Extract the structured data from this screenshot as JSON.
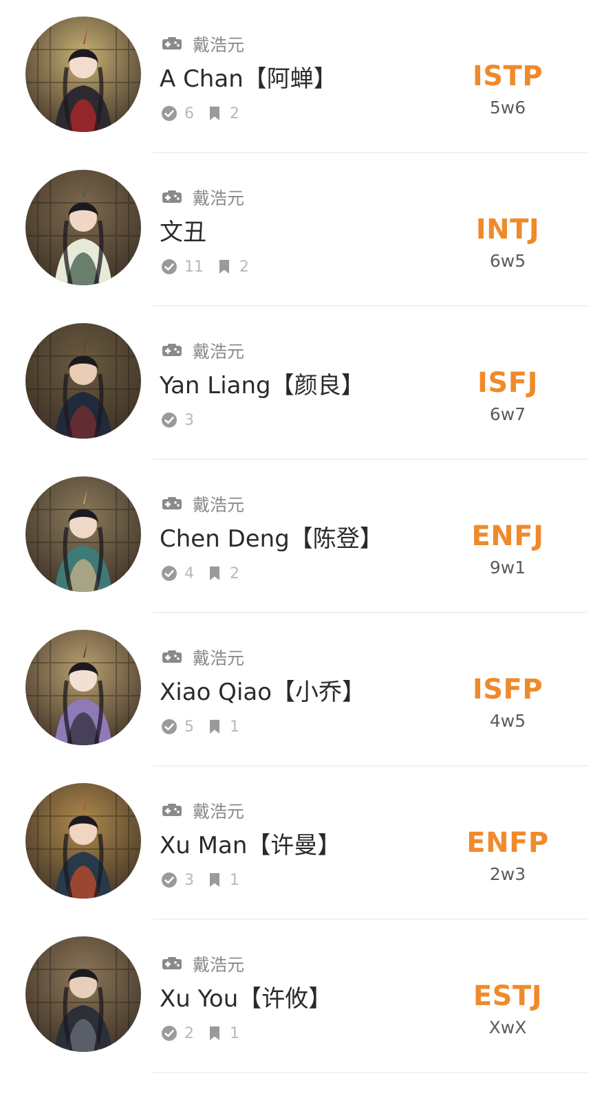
{
  "characters": [
    {
      "source": "戴浩元",
      "name": "A Chan【阿蝉】",
      "votes": "6",
      "bookmarks": "2",
      "mbti": "ISTP",
      "enneagram": "5w6",
      "palette": {
        "bg": "#c9b176",
        "robe": "#2c2a30",
        "accent": "#b4262a",
        "skin": "#f2dccb"
      }
    },
    {
      "source": "戴浩元",
      "name": "文丑",
      "votes": "11",
      "bookmarks": "2",
      "mbti": "INTJ",
      "enneagram": "6w5",
      "palette": {
        "bg": "#7d6a4e",
        "robe": "#e6ead8",
        "accent": "#3f5a4a",
        "skin": "#f0d6c4"
      }
    },
    {
      "source": "戴浩元",
      "name": "Yan Liang【颜良】",
      "votes": "3",
      "bookmarks": "",
      "mbti": "ISFJ",
      "enneagram": "6w7",
      "palette": {
        "bg": "#6a5b3f",
        "robe": "#1f2a3a",
        "accent": "#7a2e2e",
        "skin": "#e9cdb7"
      }
    },
    {
      "source": "戴浩元",
      "name": "Chen Deng【陈登】",
      "votes": "4",
      "bookmarks": "2",
      "mbti": "ENFJ",
      "enneagram": "9w1",
      "palette": {
        "bg": "#8a7a5a",
        "robe": "#3e7a76",
        "accent": "#c9b38a",
        "skin": "#efd8c8"
      }
    },
    {
      "source": "戴浩元",
      "name": "Xiao Qiao【小乔】",
      "votes": "5",
      "bookmarks": "1",
      "mbti": "ISFP",
      "enneagram": "4w5",
      "palette": {
        "bg": "#b9a070",
        "robe": "#8f7ab8",
        "accent": "#2e2e3a",
        "skin": "#f3dfd3"
      }
    },
    {
      "source": "戴浩元",
      "name": "Xu Man【许曼】",
      "votes": "3",
      "bookmarks": "1",
      "mbti": "ENFP",
      "enneagram": "2w3",
      "palette": {
        "bg": "#b08a4c",
        "robe": "#263a4a",
        "accent": "#c44a2a",
        "skin": "#efd5c2"
      }
    },
    {
      "source": "戴浩元",
      "name": "Xu You【许攸】",
      "votes": "2",
      "bookmarks": "1",
      "mbti": "ESTJ",
      "enneagram": "XwX",
      "palette": {
        "bg": "#8c7758",
        "robe": "#2a2f38",
        "accent": "#6a6f78",
        "skin": "#e8cfbb"
      }
    }
  ]
}
